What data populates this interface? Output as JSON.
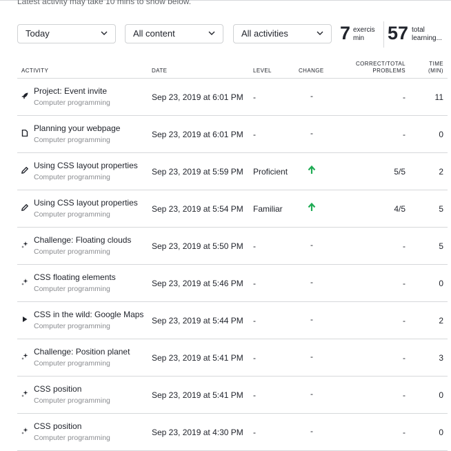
{
  "notice": "Latest activity may take 10 mins to show below.",
  "filters": {
    "time": "Today",
    "content": "All content",
    "activities": "All activities"
  },
  "stats": {
    "exercise_count": "7",
    "exercise_label": "exercise min",
    "learning_count": "57",
    "learning_label": "total learning..."
  },
  "columns": {
    "activity": "ACTIVITY",
    "date": "DATE",
    "level": "LEVEL",
    "change": "CHANGE",
    "correct_line1": "CORRECT/TOTAL",
    "correct_line2": "PROBLEMS",
    "time_line1": "TIME",
    "time_line2": "(MIN)"
  },
  "rows": [
    {
      "icon": "rocket-icon",
      "title": "Project: Event invite",
      "course": "Computer programming",
      "date": "Sep 23, 2019 at 6:01 PM",
      "level": "-",
      "change": "-",
      "correct": "-",
      "time": "11"
    },
    {
      "icon": "article-icon",
      "title": "Planning your webpage",
      "course": "Computer programming",
      "date": "Sep 23, 2019 at 6:01 PM",
      "level": "-",
      "change": "-",
      "correct": "-",
      "time": "0"
    },
    {
      "icon": "pencil-icon",
      "title": "Using CSS layout properties",
      "course": "Computer programming",
      "date": "Sep 23, 2019 at 5:59 PM",
      "level": "Proficient",
      "change": "up",
      "correct": "5/5",
      "time": "2"
    },
    {
      "icon": "pencil-icon",
      "title": "Using CSS layout properties",
      "course": "Computer programming",
      "date": "Sep 23, 2019 at 5:54 PM",
      "level": "Familiar",
      "change": "up",
      "correct": "4/5",
      "time": "5"
    },
    {
      "icon": "sparkle-icon",
      "title": "Challenge: Floating clouds",
      "course": "Computer programming",
      "date": "Sep 23, 2019 at 5:50 PM",
      "level": "-",
      "change": "-",
      "correct": "-",
      "time": "5"
    },
    {
      "icon": "sparkle-icon",
      "title": "CSS floating elements",
      "course": "Computer programming",
      "date": "Sep 23, 2019 at 5:46 PM",
      "level": "-",
      "change": "-",
      "correct": "-",
      "time": "0"
    },
    {
      "icon": "play-icon",
      "title": "CSS in the wild: Google Maps",
      "course": "Computer programming",
      "date": "Sep 23, 2019 at 5:44 PM",
      "level": "-",
      "change": "-",
      "correct": "-",
      "time": "2"
    },
    {
      "icon": "sparkle-icon",
      "title": "Challenge: Position planet",
      "course": "Computer programming",
      "date": "Sep 23, 2019 at 5:41 PM",
      "level": "-",
      "change": "-",
      "correct": "-",
      "time": "3"
    },
    {
      "icon": "sparkle-icon",
      "title": "CSS position",
      "course": "Computer programming",
      "date": "Sep 23, 2019 at 5:41 PM",
      "level": "-",
      "change": "-",
      "correct": "-",
      "time": "0"
    },
    {
      "icon": "sparkle-icon",
      "title": "CSS position",
      "course": "Computer programming",
      "date": "Sep 23, 2019 at 4:30 PM",
      "level": "-",
      "change": "-",
      "correct": "-",
      "time": "0"
    }
  ],
  "colors": {
    "up_arrow": "#1fab54",
    "muted_text": "#8a8c90",
    "divider": "#d6d8da"
  }
}
